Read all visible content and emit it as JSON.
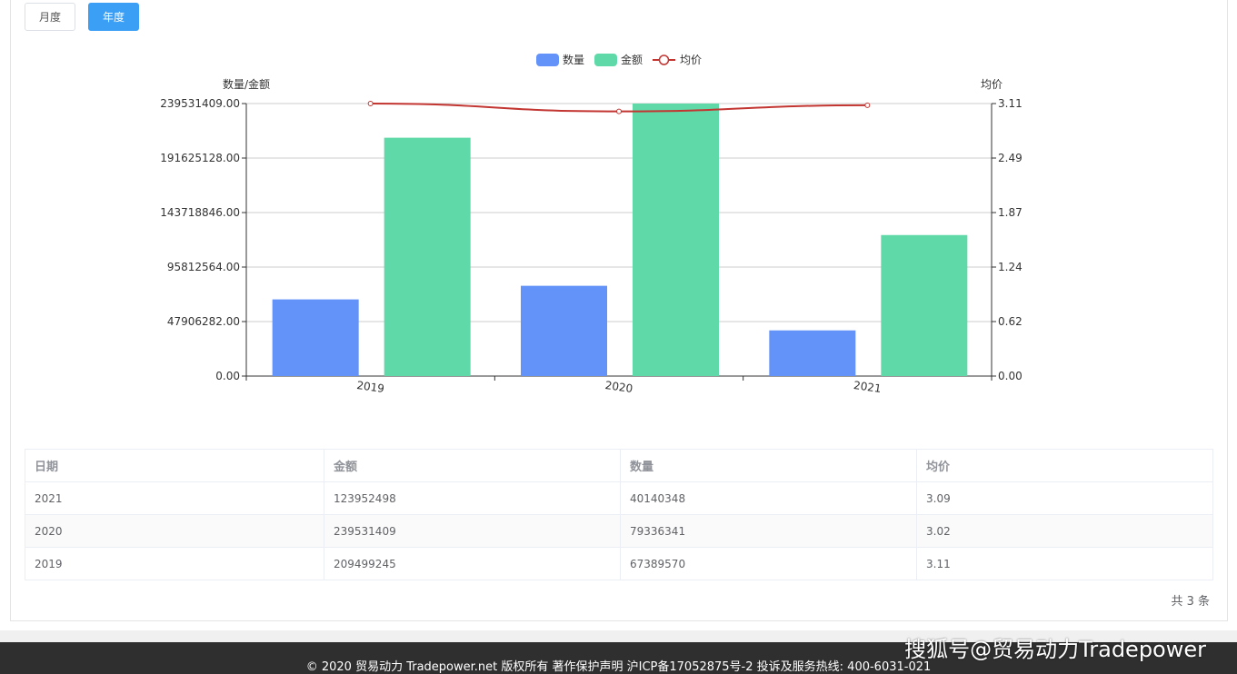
{
  "tabs": {
    "monthly_label": "月度",
    "yearly_label": "年度",
    "active": "yearly"
  },
  "colors": {
    "quantity": "#6393f8",
    "amount": "#60d9a8",
    "avg_price": "#c23531",
    "grid": "#cccccc"
  },
  "chart_data": {
    "type": "bar",
    "categories": [
      "2019",
      "2020",
      "2021"
    ],
    "series": [
      {
        "name": "数量",
        "type": "bar",
        "axis": "left",
        "values": [
          67389570,
          79336341,
          40140348
        ]
      },
      {
        "name": "金额",
        "type": "bar",
        "axis": "left",
        "values": [
          209499245,
          239531409,
          123952498
        ]
      },
      {
        "name": "均价",
        "type": "line",
        "axis": "right",
        "values": [
          3.11,
          3.02,
          3.09
        ]
      }
    ],
    "ylabel_left": "数量/金额",
    "ylabel_right": "均价",
    "ylim_left": [
      0,
      239531409
    ],
    "ylim_right": [
      0,
      3.11
    ],
    "yticks_left": [
      "0.00",
      "47906282.00",
      "95812564.00",
      "143718846.00",
      "191625128.00",
      "239531409.00"
    ],
    "yticks_right": [
      "0.00",
      "0.62",
      "1.24",
      "1.87",
      "2.49",
      "3.11"
    ],
    "grid": true,
    "legend_position": "top-center"
  },
  "table": {
    "headers": [
      "日期",
      "金额",
      "数量",
      "均价"
    ],
    "rows": [
      [
        "2021",
        "123952498",
        "40140348",
        "3.09"
      ],
      [
        "2020",
        "239531409",
        "79336341",
        "3.02"
      ],
      [
        "2019",
        "209499245",
        "67389570",
        "3.11"
      ]
    ],
    "total_text": "共 3 条"
  },
  "footer": {
    "text": "© 2020 贸易动力 Tradepower.net 版权所有 著作保护声明 沪ICP备17052875号-2 投诉及服务热线: 400-6031-021"
  },
  "watermark": {
    "text": "搜狐号@贸易动力Tradepower"
  }
}
